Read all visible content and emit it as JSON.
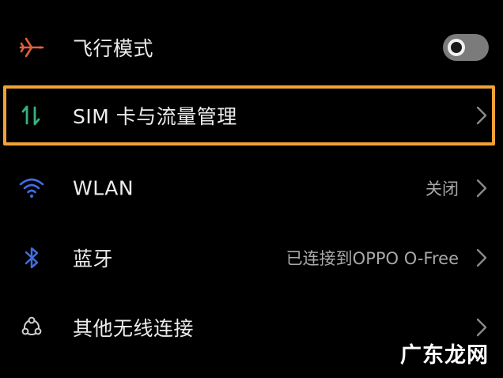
{
  "settings": {
    "items": [
      {
        "label": "飞行模式",
        "icon": "airplane-icon",
        "toggle_on": false
      },
      {
        "label": "SIM 卡与流量管理",
        "icon": "sim-data-icon",
        "highlighted": true
      },
      {
        "label": "WLAN",
        "icon": "wifi-icon",
        "value": "关闭"
      },
      {
        "label": "蓝牙",
        "icon": "bluetooth-icon",
        "value": "已连接到OPPO O-Free"
      },
      {
        "label": "其他无线连接",
        "icon": "other-wireless-icon"
      }
    ]
  },
  "colors": {
    "background": "#000000",
    "highlight_border": "#f2a234",
    "airplane_icon": "#e0603a",
    "sim_icon": "#36b37e",
    "wifi_icon": "#3f6fe0",
    "bluetooth_icon": "#3f6fe0",
    "other_icon": "#cfcfcf"
  },
  "watermark": "广东龙网"
}
